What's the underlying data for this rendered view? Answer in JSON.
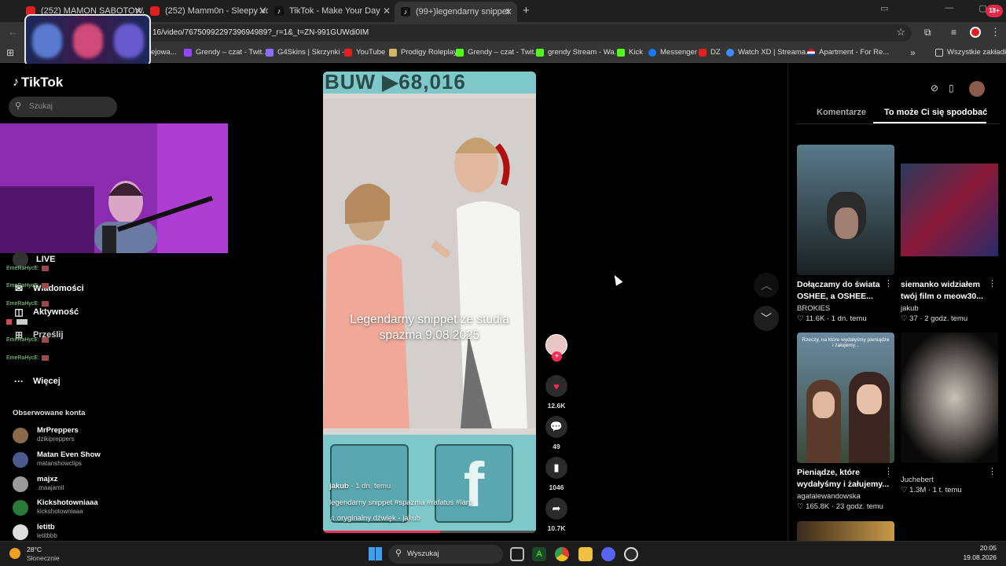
{
  "browser": {
    "tabs": [
      {
        "label": "(252) MAMON SABOTOWANY",
        "color": "#e02020"
      },
      {
        "label": "(252) Mamm0n - Sleepy Voice",
        "color": "#e02020"
      },
      {
        "label": "TikTok - Make Your Day",
        "color": "#111111"
      },
      {
        "label": "(99+)legendarny snippet #spazm",
        "color": "#111111"
      }
    ],
    "new_tab": "+",
    "url": "16/video/7675099229739694989?_r=1&_t=ZN-991GUWdi0IM",
    "bookmarks": [
      {
        "label": "ejowa...",
        "color": "#888888"
      },
      {
        "label": "Grendy – czat - Twit...",
        "color": "#9147ff"
      },
      {
        "label": "G4Skins | Skrzynki -...",
        "color": "#8a6cff"
      },
      {
        "label": "YouTube",
        "color": "#e02020"
      },
      {
        "label": "Prodigy Roleplay",
        "color": "#d4b36a"
      },
      {
        "label": "Grendy – czat - Twit...",
        "color": "#53fc18"
      },
      {
        "label": "grendy Stream - Wa...",
        "color": "#53fc18"
      },
      {
        "label": "Kick",
        "color": "#53fc18"
      },
      {
        "label": "Messenger",
        "color": "#1877f2"
      },
      {
        "label": "DZ",
        "color": "#e02020"
      },
      {
        "label": "Watch XD | Streama...",
        "color": "#3d8bff"
      },
      {
        "label": "Apartment - For Re...",
        "color": "#c8102e"
      }
    ],
    "bookmarks_all": "Wszystkie zakładki"
  },
  "sidebar": {
    "logo": "TikTok",
    "search_placeholder": "Szukaj",
    "nav": [
      {
        "label": "LIVE",
        "icon": "live-icon"
      },
      {
        "label": "Wiadomości",
        "icon": "messages-icon"
      },
      {
        "label": "Aktywność",
        "icon": "activity-icon"
      },
      {
        "label": "Prześlij",
        "icon": "upload-icon"
      },
      {
        "label": "Więcej",
        "icon": "more-icon"
      }
    ],
    "chat_overlay": [
      {
        "user": "EmeRaHycE:"
      },
      {
        "user": "EmeRaHycE:"
      },
      {
        "user": "EmeRaHycE:"
      },
      {
        "user": "EmeRaHycE:"
      },
      {
        "user": "EmeRaHycE:"
      },
      {
        "user": "EmeRaHycE:"
      }
    ],
    "following_header": "Obserwowane konta",
    "following": [
      {
        "name": "MrPreppers",
        "handle": "dzikipreppers",
        "color": "#8a6a4a"
      },
      {
        "name": "Matan Even Show",
        "handle": "matanshowclips",
        "color": "#4a5a8a"
      },
      {
        "name": "majxz",
        "handle": ".maajamil",
        "color": "#9a9a9a"
      },
      {
        "name": "Kickshotowniaaa",
        "handle": "kickshotowniaaa",
        "color": "#2a7a3a"
      },
      {
        "name": "letitb",
        "handle": "letitbbb",
        "color": "#dddddd"
      }
    ]
  },
  "video": {
    "top_text": "BUW ▶68,016",
    "caption_line1": "Legendarny snippet ze studia",
    "caption_line2": "spazma 9.08.2025",
    "author": "jakub",
    "author_time": "· 1 dn. temu",
    "description": "legendarny snippet #spazma #rafatus #larp",
    "sound": "oryginalny dźwięk - jakub",
    "likes": "12.6K",
    "comments": "49",
    "saves": "1046",
    "shares": "10.7K"
  },
  "right_panel": {
    "tabs": [
      "Komentarze",
      "To może Ci się spodobać"
    ],
    "cards": [
      {
        "title": "Dołączamy do świata OSHEE, a OSHEE...",
        "author": "BROKIES",
        "views": "11.6K",
        "time": "1 dn. temu"
      },
      {
        "title": "siemanko widziałem twój film o meow30...",
        "author": "jakub",
        "views": "37",
        "time": "2 godz. temu"
      },
      {
        "title": "Pieniądze, które wydałyśmy i żałujemy...",
        "author": "agatalewandowska",
        "views": "165.8K",
        "time": "23 godz. temu"
      },
      {
        "title": "",
        "author": "Juchebert",
        "views": "1.3M",
        "time": "1 t. temu"
      }
    ],
    "card3_overlay": "Rzeczy, na które wydałyśmy pieniądze i żałujemy..."
  },
  "taskbar": {
    "weather_temp": "28°C",
    "weather_desc": "Słonecznie",
    "search_placeholder": "Wyszukaj",
    "time": "20:05",
    "date": "19.08.2026"
  }
}
